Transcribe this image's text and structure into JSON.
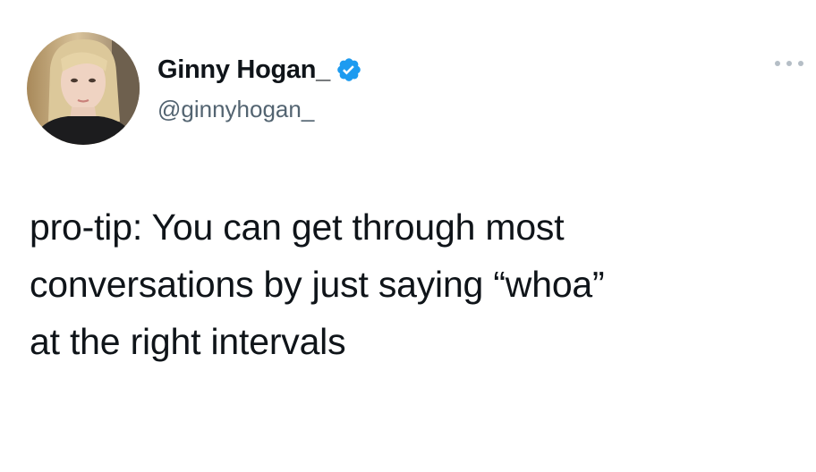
{
  "author": {
    "display_name": "Ginny Hogan_",
    "handle": "@ginnyhogan_",
    "verified_icon": "verified-badge-icon"
  },
  "tweet": {
    "lines": [
      "pro-tip: You can get through most",
      "conversations by just saying “whoa”",
      "at the right intervals"
    ]
  },
  "icons": {
    "more": "more-options-icon"
  },
  "colors": {
    "verified": "#1d9bf0",
    "handle": "#536471",
    "text": "#0f1419",
    "more": "#b5bec6"
  }
}
